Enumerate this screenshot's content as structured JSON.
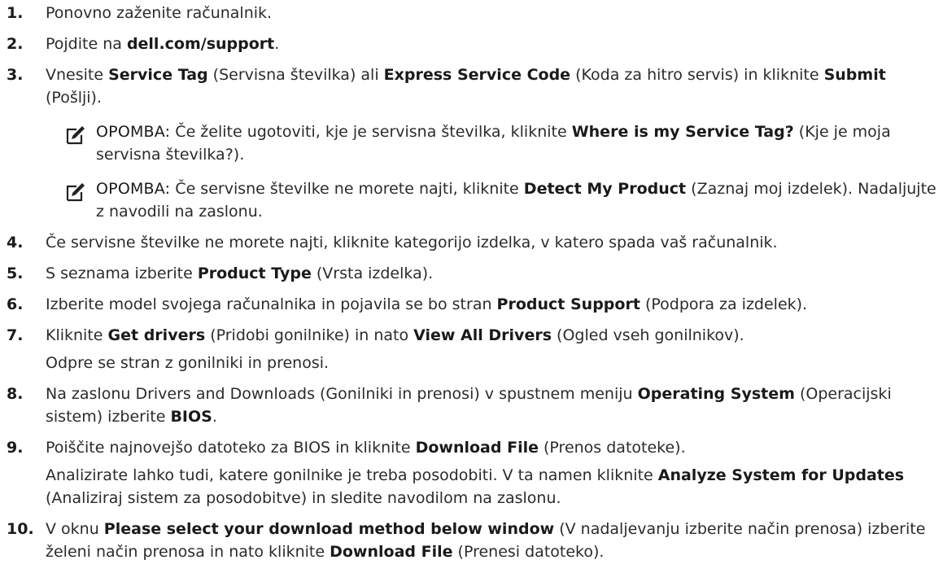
{
  "steps": [
    {
      "num": "1.",
      "parts": [
        {
          "t": "Ponovno zaženite računalnik."
        }
      ]
    },
    {
      "num": "2.",
      "parts": [
        {
          "t": "Pojdite na "
        },
        {
          "t": "dell.com/support",
          "b": true
        },
        {
          "t": "."
        }
      ]
    },
    {
      "num": "3.",
      "parts": [
        {
          "t": "Vnesite "
        },
        {
          "t": "Service Tag",
          "b": true
        },
        {
          "t": " (Servisna številka) ali "
        },
        {
          "t": "Express Service Code",
          "b": true
        },
        {
          "t": " (Koda za hitro servis) in kliknite "
        },
        {
          "t": "Submit",
          "b": true
        },
        {
          "t": " (Pošlji)."
        }
      ]
    },
    {
      "num": "4.",
      "parts": [
        {
          "t": "Če servisne številke ne morete najti, kliknite kategorijo izdelka, v katero spada vaš računalnik."
        }
      ]
    },
    {
      "num": "5.",
      "parts": [
        {
          "t": "S seznama izberite "
        },
        {
          "t": "Product Type",
          "b": true
        },
        {
          "t": " (Vrsta izdelka)."
        }
      ]
    },
    {
      "num": "6.",
      "parts": [
        {
          "t": "Izberite model svojega računalnika in pojavila se bo stran "
        },
        {
          "t": "Product Support",
          "b": true
        },
        {
          "t": " (Podpora za izdelek)."
        }
      ]
    },
    {
      "num": "7.",
      "parts": [
        {
          "t": "Kliknite "
        },
        {
          "t": "Get drivers",
          "b": true
        },
        {
          "t": " (Pridobi gonilnike) in nato "
        },
        {
          "t": "View All Drivers",
          "b": true
        },
        {
          "t": " (Ogled vseh gonilnikov)."
        }
      ],
      "sub": [
        {
          "t": "Odpre se stran z gonilniki in prenosi."
        }
      ]
    },
    {
      "num": "8.",
      "parts": [
        {
          "t": "Na zaslonu Drivers and Downloads (Gonilniki in prenosi) v spustnem meniju "
        },
        {
          "t": "Operating System",
          "b": true
        },
        {
          "t": " (Operacijski sistem) izberite "
        },
        {
          "t": "BIOS",
          "b": true
        },
        {
          "t": "."
        }
      ]
    },
    {
      "num": "9.",
      "parts": [
        {
          "t": "Poiščite najnovejšo datoteko za BIOS in kliknite "
        },
        {
          "t": "Download File",
          "b": true
        },
        {
          "t": " (Prenos datoteke)."
        }
      ],
      "sub": [
        {
          "t": "Analizirate lahko tudi, katere gonilnike je treba posodobiti. V ta namen kliknite "
        },
        {
          "t": "Analyze System for Updates",
          "b": true
        },
        {
          "t": " (Analiziraj sistem za posodobitve) in sledite navodilom na zaslonu."
        }
      ]
    },
    {
      "num": "10.",
      "parts": [
        {
          "t": "V oknu "
        },
        {
          "t": "Please select your download method below window",
          "b": true
        },
        {
          "t": " (V nadaljevanju izberite način prenosa) izberite želeni način prenosa in nato kliknite "
        },
        {
          "t": "Download File",
          "b": true
        },
        {
          "t": " (Prenesi datoteko)."
        }
      ]
    }
  ],
  "notes": [
    {
      "label": "OPOMBA:",
      "icon": "pencil-note-icon",
      "parts": [
        {
          "t": " Če želite ugotoviti, kje je servisna številka, kliknite "
        },
        {
          "t": "Where is my Service Tag?",
          "b": true
        },
        {
          "t": " (Kje je moja servisna številka?)."
        }
      ]
    },
    {
      "label": "OPOMBA:",
      "icon": "pencil-note-icon",
      "parts": [
        {
          "t": " Če servisne številke ne morete najti, kliknite "
        },
        {
          "t": "Detect My Product",
          "b": true
        },
        {
          "t": " (Zaznaj moj izdelek). Nadaljujte z navodili na zaslonu."
        }
      ]
    }
  ]
}
